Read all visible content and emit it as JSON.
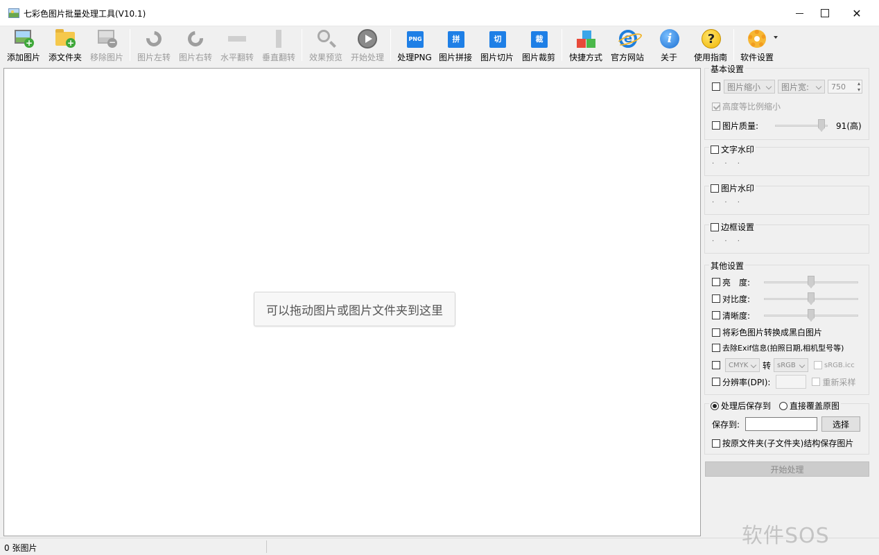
{
  "window": {
    "title": "七彩色图片批量处理工具(V10.1)"
  },
  "toolbar": {
    "add_image": "添加图片",
    "add_folder": "添文件夹",
    "remove_image": "移除图片",
    "rotate_left": "图片左转",
    "rotate_right": "图片右转",
    "flip_h": "水平翻转",
    "flip_v": "垂直翻转",
    "preview": "效果预览",
    "start": "开始处理",
    "png": "处理PNG",
    "png_icon_text": "PNG",
    "stitch": "图片拼接",
    "stitch_icon_text": "拼",
    "slice": "图片切片",
    "slice_icon_text": "切",
    "crop": "图片裁剪",
    "crop_icon_text": "裁",
    "shortcut": "快捷方式",
    "website": "官方网站",
    "about": "关于",
    "guide": "使用指南",
    "settings": "软件设置"
  },
  "main": {
    "drop_hint": "可以拖动图片或图片文件夹到这里"
  },
  "panel": {
    "basic": {
      "title": "基本设置",
      "resize_mode": "图片缩小",
      "resize_by": "图片宽:",
      "width_value": "750",
      "keep_ratio": "高度等比例缩小",
      "quality_label": "图片质量:",
      "quality_value": "91(高)"
    },
    "text_watermark": {
      "label": "文字水印",
      "dots": "· · ·"
    },
    "image_watermark": {
      "label": "图片水印",
      "dots": "· · ·"
    },
    "border": {
      "label": "边框设置",
      "dots": "· · ·"
    },
    "other": {
      "title": "其他设置",
      "brightness": "亮　度:",
      "contrast": "对比度:",
      "sharpness": "清晰度:",
      "grayscale": "将彩色图片转换成黑白图片",
      "remove_exif": "去除Exif信息(拍照日期,相机型号等)",
      "color_from": "CMYK",
      "convert_word": "转",
      "color_to": "sRGB",
      "icc": "sRGB.icc",
      "dpi_label": "分辨率(DPI):",
      "resample": "重新采样"
    },
    "output": {
      "save_to_option": "处理后保存到",
      "overwrite_option": "直接覆盖原图",
      "save_label": "保存到:",
      "save_path": "",
      "choose": "选择",
      "keep_structure": "按原文件夹(子文件夹)结构保存图片"
    },
    "start_button": "开始处理"
  },
  "status": {
    "count_text": "0 张图片"
  },
  "watermark_text": "软件SOS"
}
